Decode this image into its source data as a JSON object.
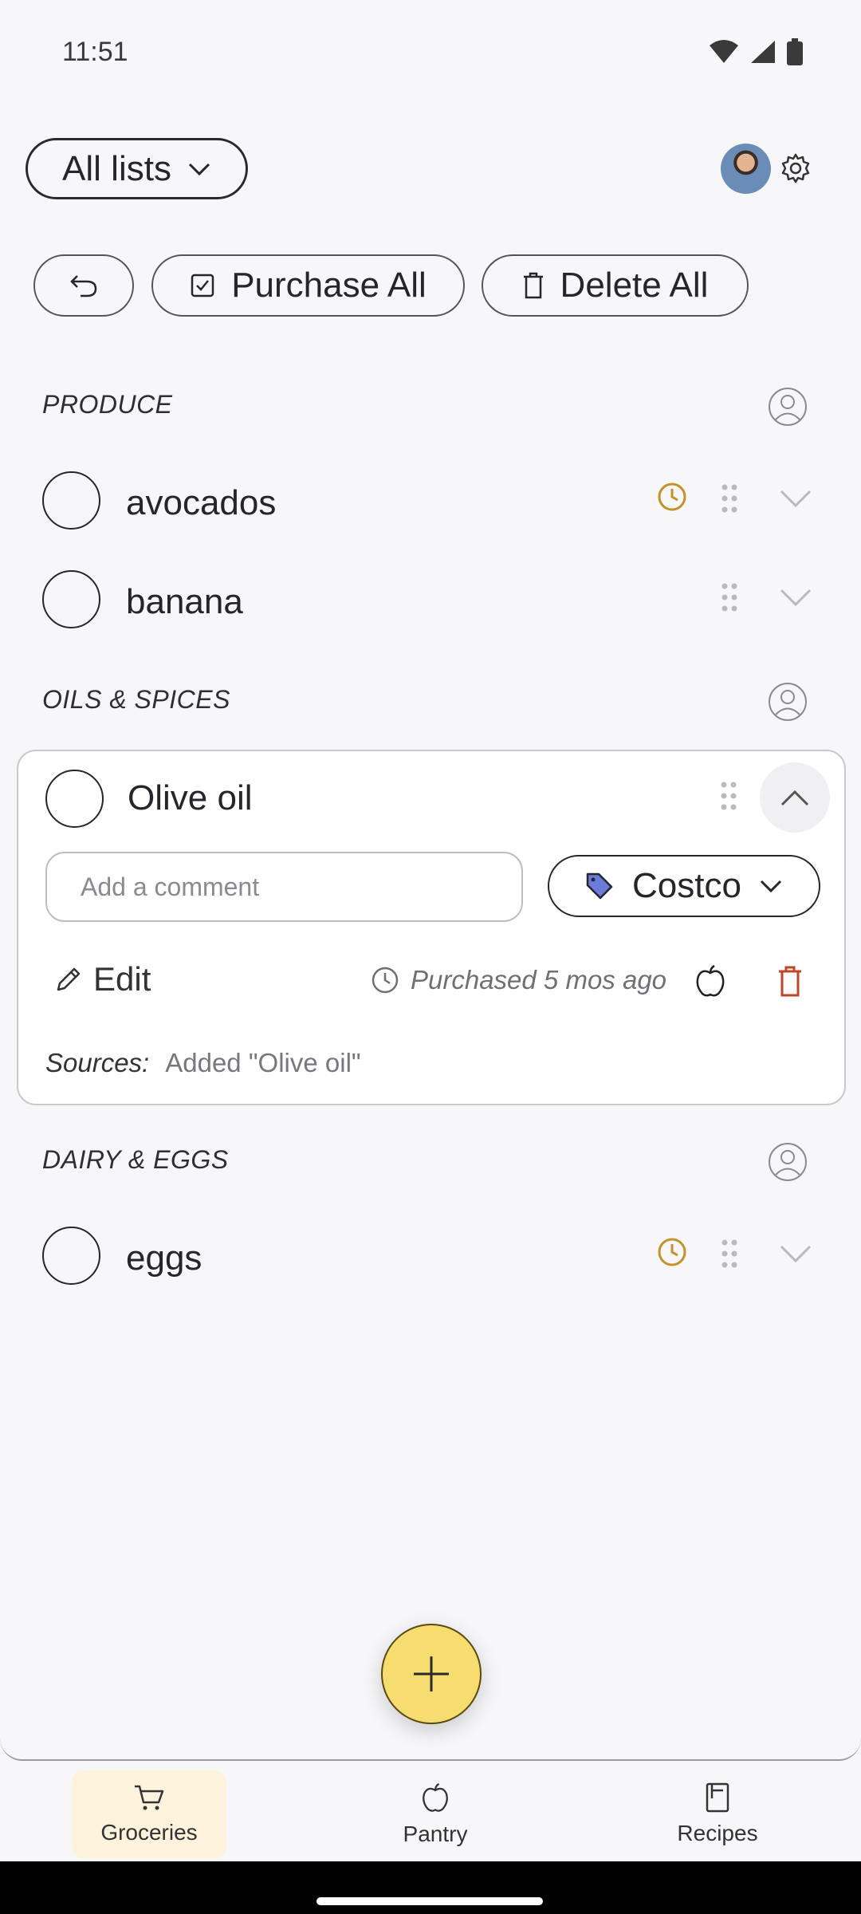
{
  "status_bar": {
    "time": "11:51"
  },
  "header": {
    "list_selector": "All lists"
  },
  "toolbar": {
    "purchase_all": "Purchase All",
    "delete_all": "Delete All"
  },
  "sections": [
    {
      "title": "PRODUCE",
      "items": [
        {
          "name": "avocados"
        },
        {
          "name": "banana"
        }
      ]
    },
    {
      "title": "OILS & SPICES",
      "items": [
        {
          "name": "Olive oil"
        }
      ]
    },
    {
      "title": "DAIRY & EGGS",
      "items": [
        {
          "name": "eggs"
        }
      ]
    }
  ],
  "expanded_item": {
    "comment_placeholder": "Add a comment",
    "store": "Costco",
    "edit_label": "Edit",
    "purchased_text": "Purchased 5 mos ago",
    "sources_label": "Sources:",
    "sources_value": "Added \"Olive oil\""
  },
  "bottom_nav": [
    {
      "label": "Groceries"
    },
    {
      "label": "Pantry"
    },
    {
      "label": "Recipes"
    }
  ],
  "colors": {
    "accent": "#f7dc6f",
    "clock": "#c4912a",
    "delete": "#c0462a",
    "tag": "#6b7bd9"
  }
}
